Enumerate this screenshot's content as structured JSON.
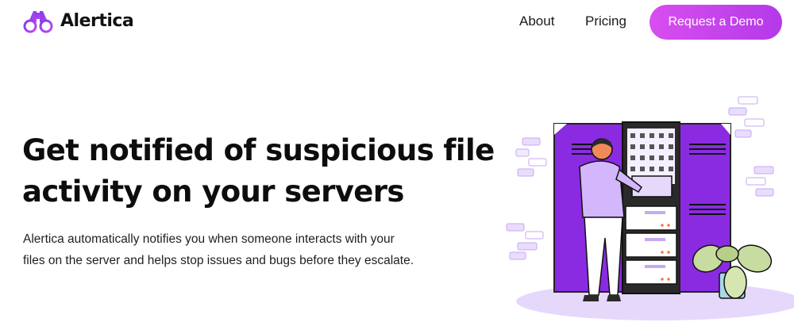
{
  "brand": {
    "name": "Alertica",
    "logo_icon": "binoculars-icon",
    "accent": "#c24ae8",
    "accent_light": "#e0c8fb",
    "primary": "#8a2be2"
  },
  "nav": {
    "links": [
      {
        "label": "About"
      },
      {
        "label": "Pricing"
      }
    ],
    "cta_label": "Request a Demo"
  },
  "hero": {
    "title_line1": "Get notified of suspicious file",
    "title_line2": "activity on your servers",
    "subtitle_line1": "Alertica automatically notifies you when someone interacts with your",
    "subtitle_line2": "files on the server and helps stop issues and bugs before they escalate."
  },
  "illustration": {
    "icon": "server-rack-person-illustration"
  }
}
